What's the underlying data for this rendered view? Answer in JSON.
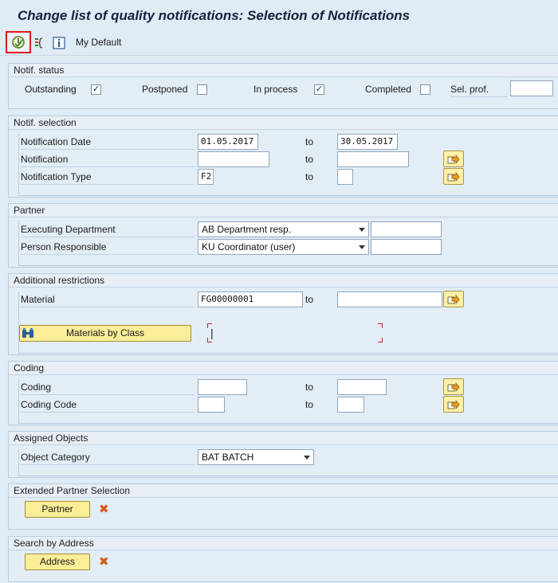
{
  "title": "Change list of quality notifications: Selection of Notifications",
  "toolbar": {
    "execute_icon": "execute-clock-icon",
    "my_default": "My Default"
  },
  "notif_status": {
    "header": "Notif. status",
    "outstanding": "Outstanding",
    "outstanding_checked": "✓",
    "postponed": "Postponed",
    "postponed_checked": "",
    "in_process": "In process",
    "in_process_checked": "✓",
    "completed": "Completed",
    "completed_checked": "",
    "sel_prof": "Sel. prof.",
    "sel_prof_value": ""
  },
  "notif_selection": {
    "header": "Notif. selection",
    "to": "to",
    "rows": [
      {
        "label": "Notification Date",
        "from": "01.05.2017",
        "to": "30.05.2017"
      },
      {
        "label": "Notification",
        "from": "",
        "to": ""
      },
      {
        "label": "Notification Type",
        "from": "F2",
        "to": ""
      }
    ]
  },
  "partner": {
    "header": "Partner",
    "rows": [
      {
        "label": "Executing Department",
        "select": "AB Department resp.",
        "value": ""
      },
      {
        "label": "Person Responsible",
        "select": "KU Coordinator (user)",
        "value": ""
      }
    ]
  },
  "additional": {
    "header": "Additional restrictions",
    "material_label": "Material",
    "material_from": "FG00000001",
    "to": "to",
    "material_to": "",
    "class_button": "Materials by Class",
    "class_value": "|"
  },
  "coding": {
    "header": "Coding",
    "to": "to",
    "rows": [
      {
        "label": "Coding",
        "from": "",
        "to": ""
      },
      {
        "label": "Coding Code",
        "from": "",
        "to": ""
      }
    ]
  },
  "assigned": {
    "header": "Assigned Objects",
    "object_category_label": "Object Category",
    "object_category_value": "BAT BATCH"
  },
  "extended_partner": {
    "header": "Extended Partner Selection",
    "button": "Partner"
  },
  "search_address": {
    "header": "Search by Address",
    "button": "Address"
  },
  "colors": {
    "background": "#dfebf5",
    "button_yellow": "#fbee98",
    "highlight_red": "#e0191b",
    "delete_orange": "#d35a1b"
  }
}
